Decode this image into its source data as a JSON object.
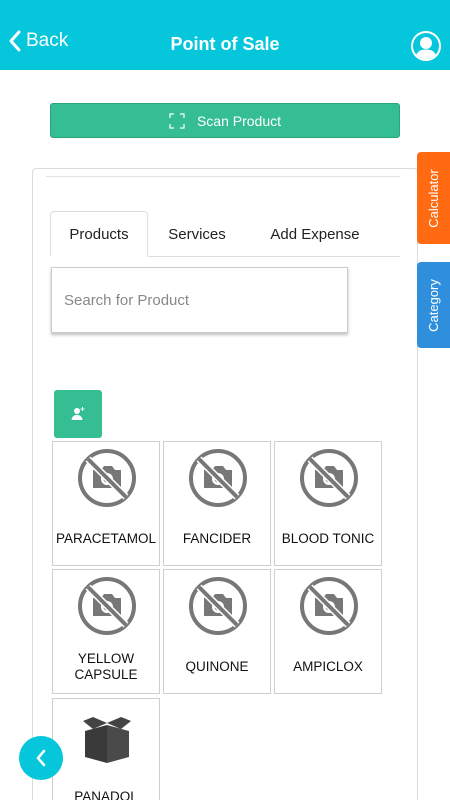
{
  "header": {
    "back_label": "Back",
    "title": "Point of Sale",
    "background": "#06c6dc"
  },
  "scan_button": {
    "label": "Scan Product",
    "icon": "scan-frame-icon",
    "color": "#35be92"
  },
  "tabs": [
    {
      "label": "Products",
      "active": true
    },
    {
      "label": "Services",
      "active": false
    },
    {
      "label": "Add Expense",
      "active": false
    }
  ],
  "search": {
    "placeholder": "Search for Product",
    "value": ""
  },
  "side_tabs": {
    "calculator": {
      "label": "Calculator",
      "color": "#ff6a13"
    },
    "category": {
      "label": "Category",
      "color": "#2f8fdc"
    }
  },
  "products": [
    {
      "name": "PARACETAMOL",
      "image": "no-photo-icon"
    },
    {
      "name": "FANCIDER",
      "image": "no-photo-icon"
    },
    {
      "name": "BLOOD TONIC",
      "image": "no-photo-icon"
    },
    {
      "name": "YELLOW CAPSULE",
      "image": "no-photo-icon"
    },
    {
      "name": "QUINONE",
      "image": "no-photo-icon"
    },
    {
      "name": "AMPICLOX",
      "image": "no-photo-icon"
    },
    {
      "name": "PANADOL",
      "image": "open-box-icon"
    }
  ]
}
